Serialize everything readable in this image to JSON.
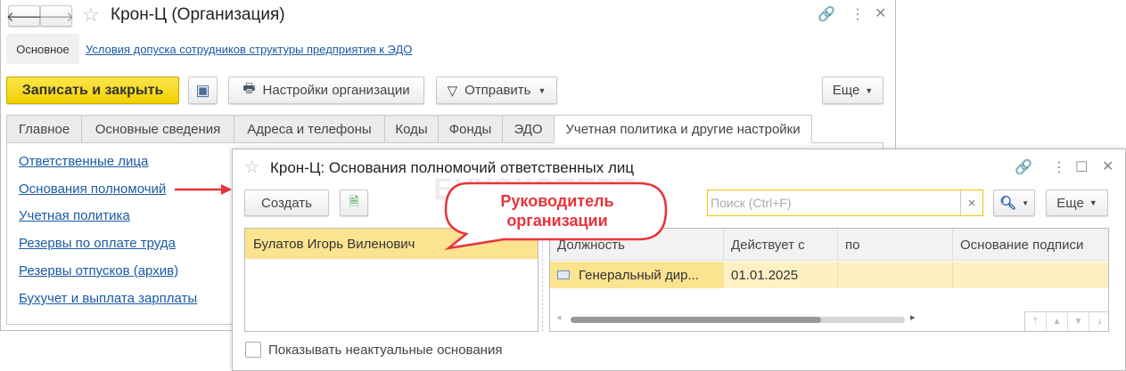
{
  "main_window": {
    "title": "Крон-Ц (Организация)",
    "nav_section": "Основное",
    "nav_link": "Условия допуска сотрудников структуры предприятия к ЭДО",
    "toolbar": {
      "save_close": "Записать и закрыть",
      "org_settings": "Настройки организации",
      "send": "Отправить",
      "more": "Еще"
    },
    "tabs": [
      "Главное",
      "Основные сведения",
      "Адреса и телефоны",
      "Коды",
      "Фонды",
      "ЭДО",
      "Учетная политика и другие настройки"
    ],
    "links": [
      "Ответственные лица",
      "Основания полномочий",
      "Учетная политика",
      "Резервы по оплате труда",
      "Резервы отпусков (архив)",
      "Бухучет и выплата зарплаты"
    ]
  },
  "dialog": {
    "title": "Крон-Ц: Основания полномочий ответственных лиц",
    "create": "Создать",
    "search_placeholder": "Поиск (Ctrl+F)",
    "search_clear": "×",
    "more": "Еще",
    "persons": [
      "Булатов Игорь Виленович"
    ],
    "columns": [
      "Должность",
      "Действует с",
      "по",
      "Основание подписи"
    ],
    "rows": [
      {
        "position": "Генеральный дир...",
        "from": "01.01.2025",
        "to": "",
        "basis": ""
      }
    ],
    "show_inactive": "Показывать неактуальные основания",
    "show_inactive_checked": false
  },
  "callout": {
    "line1": "Руководитель",
    "line2": "организации"
  },
  "watermark": "БУХЭКСПЕРТ",
  "colors": {
    "accent_yellow": "#f5d600",
    "selection": "#fbe390",
    "link": "#1b5aa4",
    "callout_red": "#e8333b"
  }
}
